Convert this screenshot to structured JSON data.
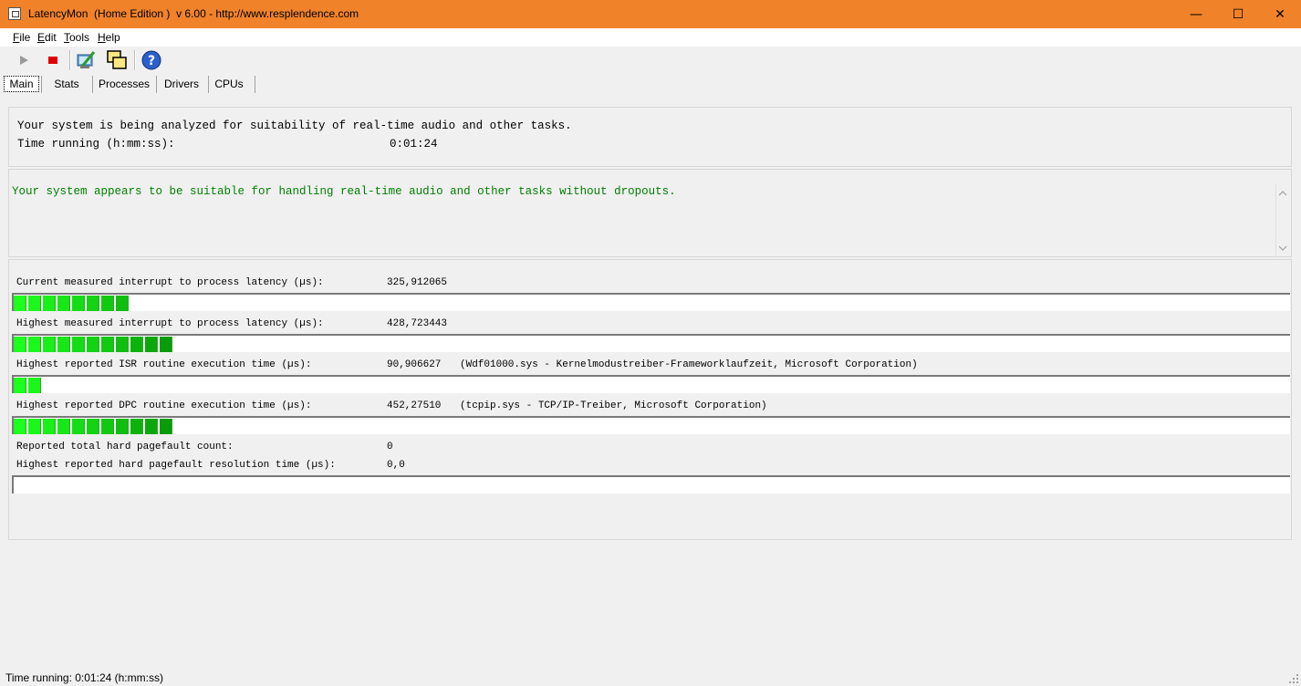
{
  "window": {
    "title": "LatencyMon  (Home Edition )  v 6.00 - http://www.resplendence.com",
    "minimize": "—",
    "maximize": "☐",
    "close": "✕",
    "accent_color": "#f0822a"
  },
  "menu": [
    {
      "label": "File"
    },
    {
      "label": "Edit"
    },
    {
      "label": "Tools"
    },
    {
      "label": "Help"
    }
  ],
  "toolbar": {
    "buttons": [
      "play-icon",
      "stop-icon",
      "analyze-icon",
      "windows-icon",
      "help-icon"
    ]
  },
  "tabs": [
    {
      "label": "Main",
      "active": true
    },
    {
      "label": "Stats"
    },
    {
      "label": "Processes"
    },
    {
      "label": "Drivers"
    },
    {
      "label": "CPUs"
    }
  ],
  "info": {
    "analyzing_text": "Your system is being analyzed for suitability of real-time audio and other tasks.",
    "time_label": "Time running (h:mm:ss):",
    "time_value": "0:01:24"
  },
  "verdict": {
    "text": "Your system appears to be suitable for handling real-time audio and other tasks without dropouts.",
    "color": "#008000"
  },
  "metrics": [
    {
      "label": "Current measured interrupt to process latency (µs):",
      "value": "325,912065",
      "detail": "",
      "segments": 8
    },
    {
      "label": "Highest measured interrupt to process latency (µs):",
      "value": "428,723443",
      "detail": "",
      "segments": 11
    },
    {
      "label": "Highest reported ISR routine execution time (µs):",
      "value": "90,906627",
      "detail": "(Wdf01000.sys - Kernelmodustreiber-Frameworklaufzeit, Microsoft Corporation)",
      "segments": 2
    },
    {
      "label": "Highest reported DPC routine execution time (µs):",
      "value": "452,27510",
      "detail": "(tcpip.sys - TCP/IP-Treiber, Microsoft Corporation)",
      "segments": 11
    }
  ],
  "pagefault": {
    "count_label": "Reported total hard pagefault count:",
    "count_value": "0",
    "resolution_label": "Highest reported hard pagefault resolution time (µs):",
    "resolution_value": "0,0",
    "segments": 0
  },
  "statusbar": {
    "text": "Time running: 0:01:24  (h:mm:ss)"
  }
}
